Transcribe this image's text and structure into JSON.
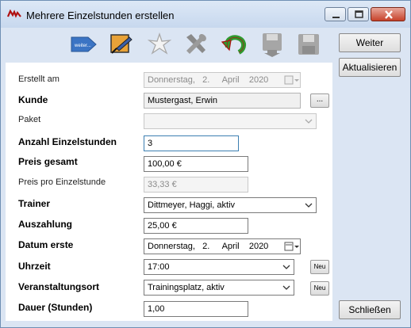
{
  "window": {
    "title": "Mehrere Einzelstunden erstellen"
  },
  "toolbar": {
    "weiter_small_label": "weiter...",
    "icons": [
      "arrow-tag-icon",
      "edit-document-icon",
      "star-outline-icon",
      "tools-icon",
      "undo-arrow-icon",
      "save-as-icon",
      "save-icon"
    ]
  },
  "side": {
    "weiter": "Weiter",
    "aktualisieren": "Aktualisieren",
    "schliessen": "Schließen"
  },
  "form": {
    "erstellt_am": {
      "label": "Erstellt am",
      "weekday": "Donnerstag,",
      "day": "2.",
      "month": "April",
      "year": "2020"
    },
    "kunde": {
      "label": "Kunde",
      "value": "Mustergast, Erwin",
      "button": "..."
    },
    "paket": {
      "label": "Paket",
      "value": ""
    },
    "anzahl": {
      "label": "Anzahl Einzelstunden",
      "value": "3"
    },
    "preis_gesamt": {
      "label": "Preis gesamt",
      "value": "100,00 €"
    },
    "preis_pro": {
      "label": "Preis pro Einzelstunde",
      "value": "33,33 €"
    },
    "trainer": {
      "label": "Trainer",
      "value": "Dittmeyer, Haggi, aktiv"
    },
    "auszahlung": {
      "label": "Auszahlung",
      "value": "25,00 €"
    },
    "datum_erste": {
      "label": "Datum erste",
      "weekday": "Donnerstag,",
      "day": "2.",
      "month": "April",
      "year": "2020"
    },
    "uhrzeit": {
      "label": "Uhrzeit",
      "value": "17:00",
      "button": "Neu"
    },
    "ort": {
      "label": "Veranstaltungsort",
      "value": "Trainingsplatz, aktiv",
      "button": "Neu"
    },
    "dauer": {
      "label": "Dauer (Stunden)",
      "value": "1,00"
    }
  }
}
